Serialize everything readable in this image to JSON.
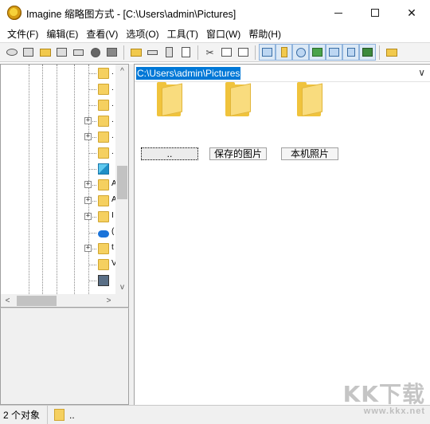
{
  "window": {
    "title": "Imagine 缩略图方式 - [C:\\Users\\admin\\Pictures]",
    "minimize": "—",
    "maximize": "☐",
    "close": "✕"
  },
  "menu": [
    "文件(F)",
    "编辑(E)",
    "查看(V)",
    "选项(O)",
    "工具(T)",
    "窗口(W)",
    "帮助(H)"
  ],
  "toolbar": {
    "icons": [
      "view-icon",
      "browse-icon",
      "open-folder-icon",
      "save-all-icon",
      "print-icon",
      "info-icon",
      "camera-icon",
      "new-folder-icon",
      "rename-icon",
      "delete-icon",
      "properties-icon",
      "cut-icon",
      "copy-icon",
      "paste-icon",
      "thumbnail-view-icon",
      "tree-view-icon",
      "clock-icon",
      "filter-icon",
      "grid-icon",
      "details-icon",
      "slideshow-icon",
      "up-folder-icon"
    ]
  },
  "tree": {
    "scroll_up": "^",
    "scroll_down": "v",
    "scroll_left": "<",
    "scroll_right": ">",
    "rows": [
      {
        "icon": "folder-icon",
        "expander": "",
        "trail": "."
      },
      {
        "icon": "folder-icon",
        "expander": "",
        "trail": "."
      },
      {
        "icon": "folder-icon",
        "expander": "",
        "trail": "."
      },
      {
        "icon": "folder-icon",
        "expander": "+",
        "trail": "."
      },
      {
        "icon": "folder-icon",
        "expander": "+",
        "trail": "."
      },
      {
        "icon": "folder-icon",
        "expander": "",
        "trail": "."
      },
      {
        "icon": "3d-objects-icon",
        "expander": "",
        "trail": ""
      },
      {
        "icon": "folder-icon",
        "expander": "+",
        "trail": "A"
      },
      {
        "icon": "folder-icon",
        "expander": "+",
        "trail": "A"
      },
      {
        "icon": "folder-icon",
        "expander": "+",
        "trail": "I"
      },
      {
        "icon": "onedrive-icon",
        "expander": "",
        "trail": "("
      },
      {
        "icon": "folder-icon",
        "expander": "+",
        "trail": "t"
      },
      {
        "icon": "folder-icon",
        "expander": "",
        "trail": "V"
      },
      {
        "icon": "network-drive-icon",
        "expander": "",
        "trail": ""
      }
    ]
  },
  "address": {
    "path": "C:\\Users\\admin\\Pictures",
    "dropdown": "∨"
  },
  "thumbnails": [
    {
      "label": "..",
      "selected": true
    },
    {
      "label": "保存的图片",
      "selected": false
    },
    {
      "label": "本机照片",
      "selected": false
    }
  ],
  "status": {
    "count": "2 个对象",
    "current": ".."
  },
  "watermark": {
    "big": "KK下载",
    "small": "www.kkx.net"
  }
}
